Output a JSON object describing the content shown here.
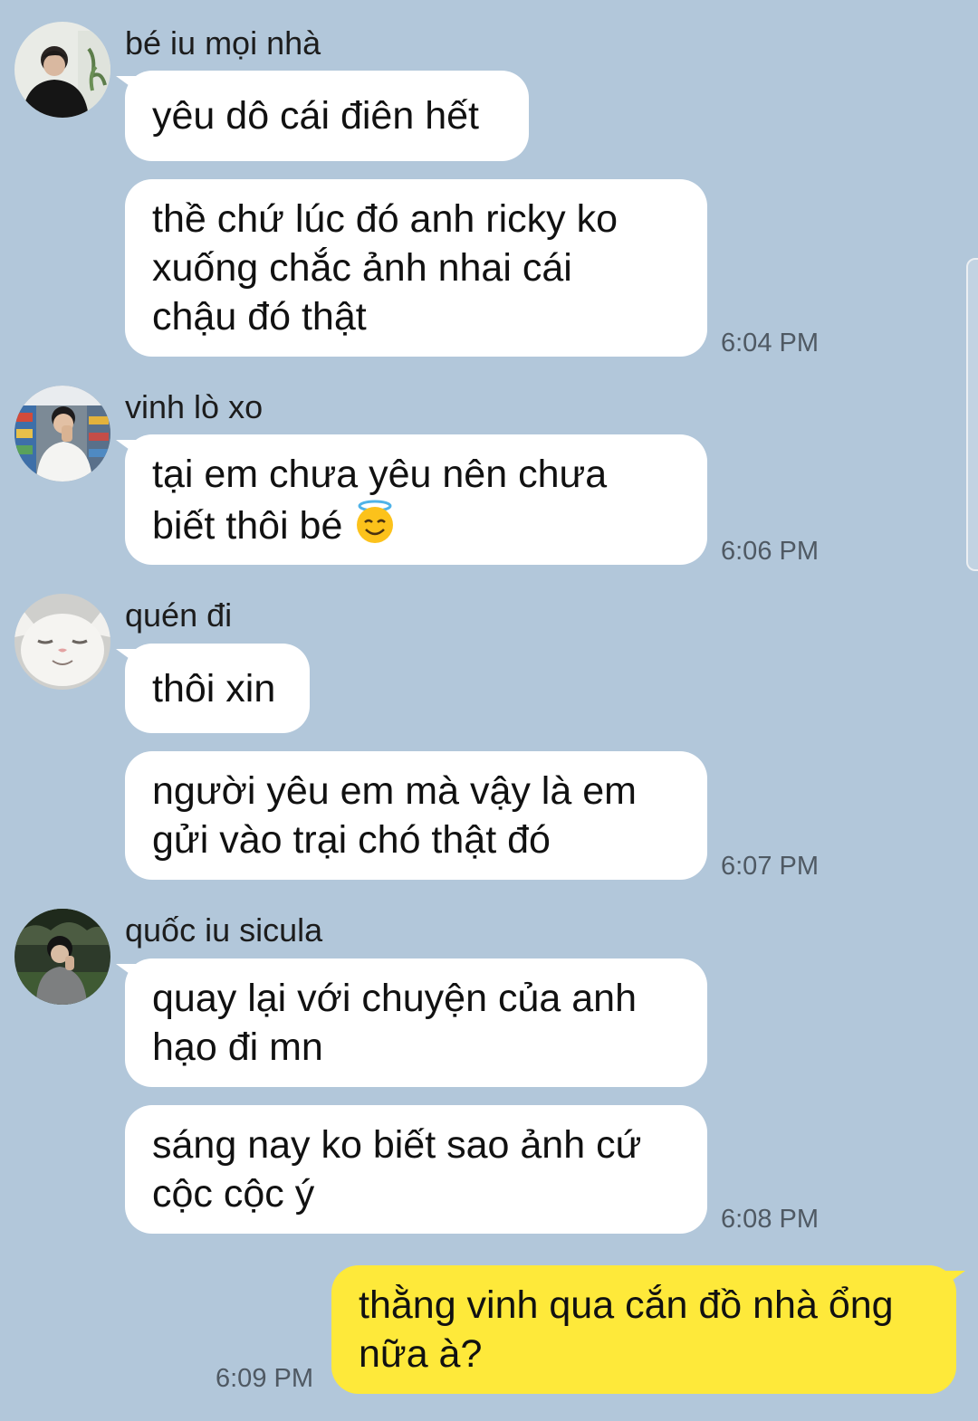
{
  "messages": [
    {
      "sender": "bé iu mọi nhà",
      "avatar": "profile-photo",
      "bubbles": [
        "yêu dô cái điên hết",
        "thề chứ lúc đó anh ricky ko\nxuống chắc ảnh nhai cái\nchậu đó thật"
      ],
      "time": "6:04 PM"
    },
    {
      "sender": "vinh lò xo",
      "avatar": "profile-photo",
      "bubbles": [
        "tại em chưa yêu nên chưa\nbiết thôi bé"
      ],
      "emoji": "smiling-face-with-halo",
      "time": "6:06 PM"
    },
    {
      "sender": "quén đi",
      "avatar": "cat-photo",
      "bubbles": [
        "thôi xin",
        "người yêu em mà vậy là em\ngửi vào trại chó thật đó"
      ],
      "time": "6:07 PM"
    },
    {
      "sender": "quốc iu sicula",
      "avatar": "profile-photo",
      "bubbles": [
        "quay lại với chuyện của anh\nhạo đi mn",
        "sáng nay ko biết sao ảnh cứ\ncộc cộc ý"
      ],
      "time": "6:08 PM"
    }
  ],
  "my_message": {
    "text": "thằng vinh qua cắn đồ nhà ổng\nnữa à?",
    "time": "6:09 PM"
  },
  "colors": {
    "background": "#b2c7da",
    "incoming_bubble": "#ffffff",
    "outgoing_bubble": "#fee93a",
    "timestamp": "#4f5963"
  }
}
